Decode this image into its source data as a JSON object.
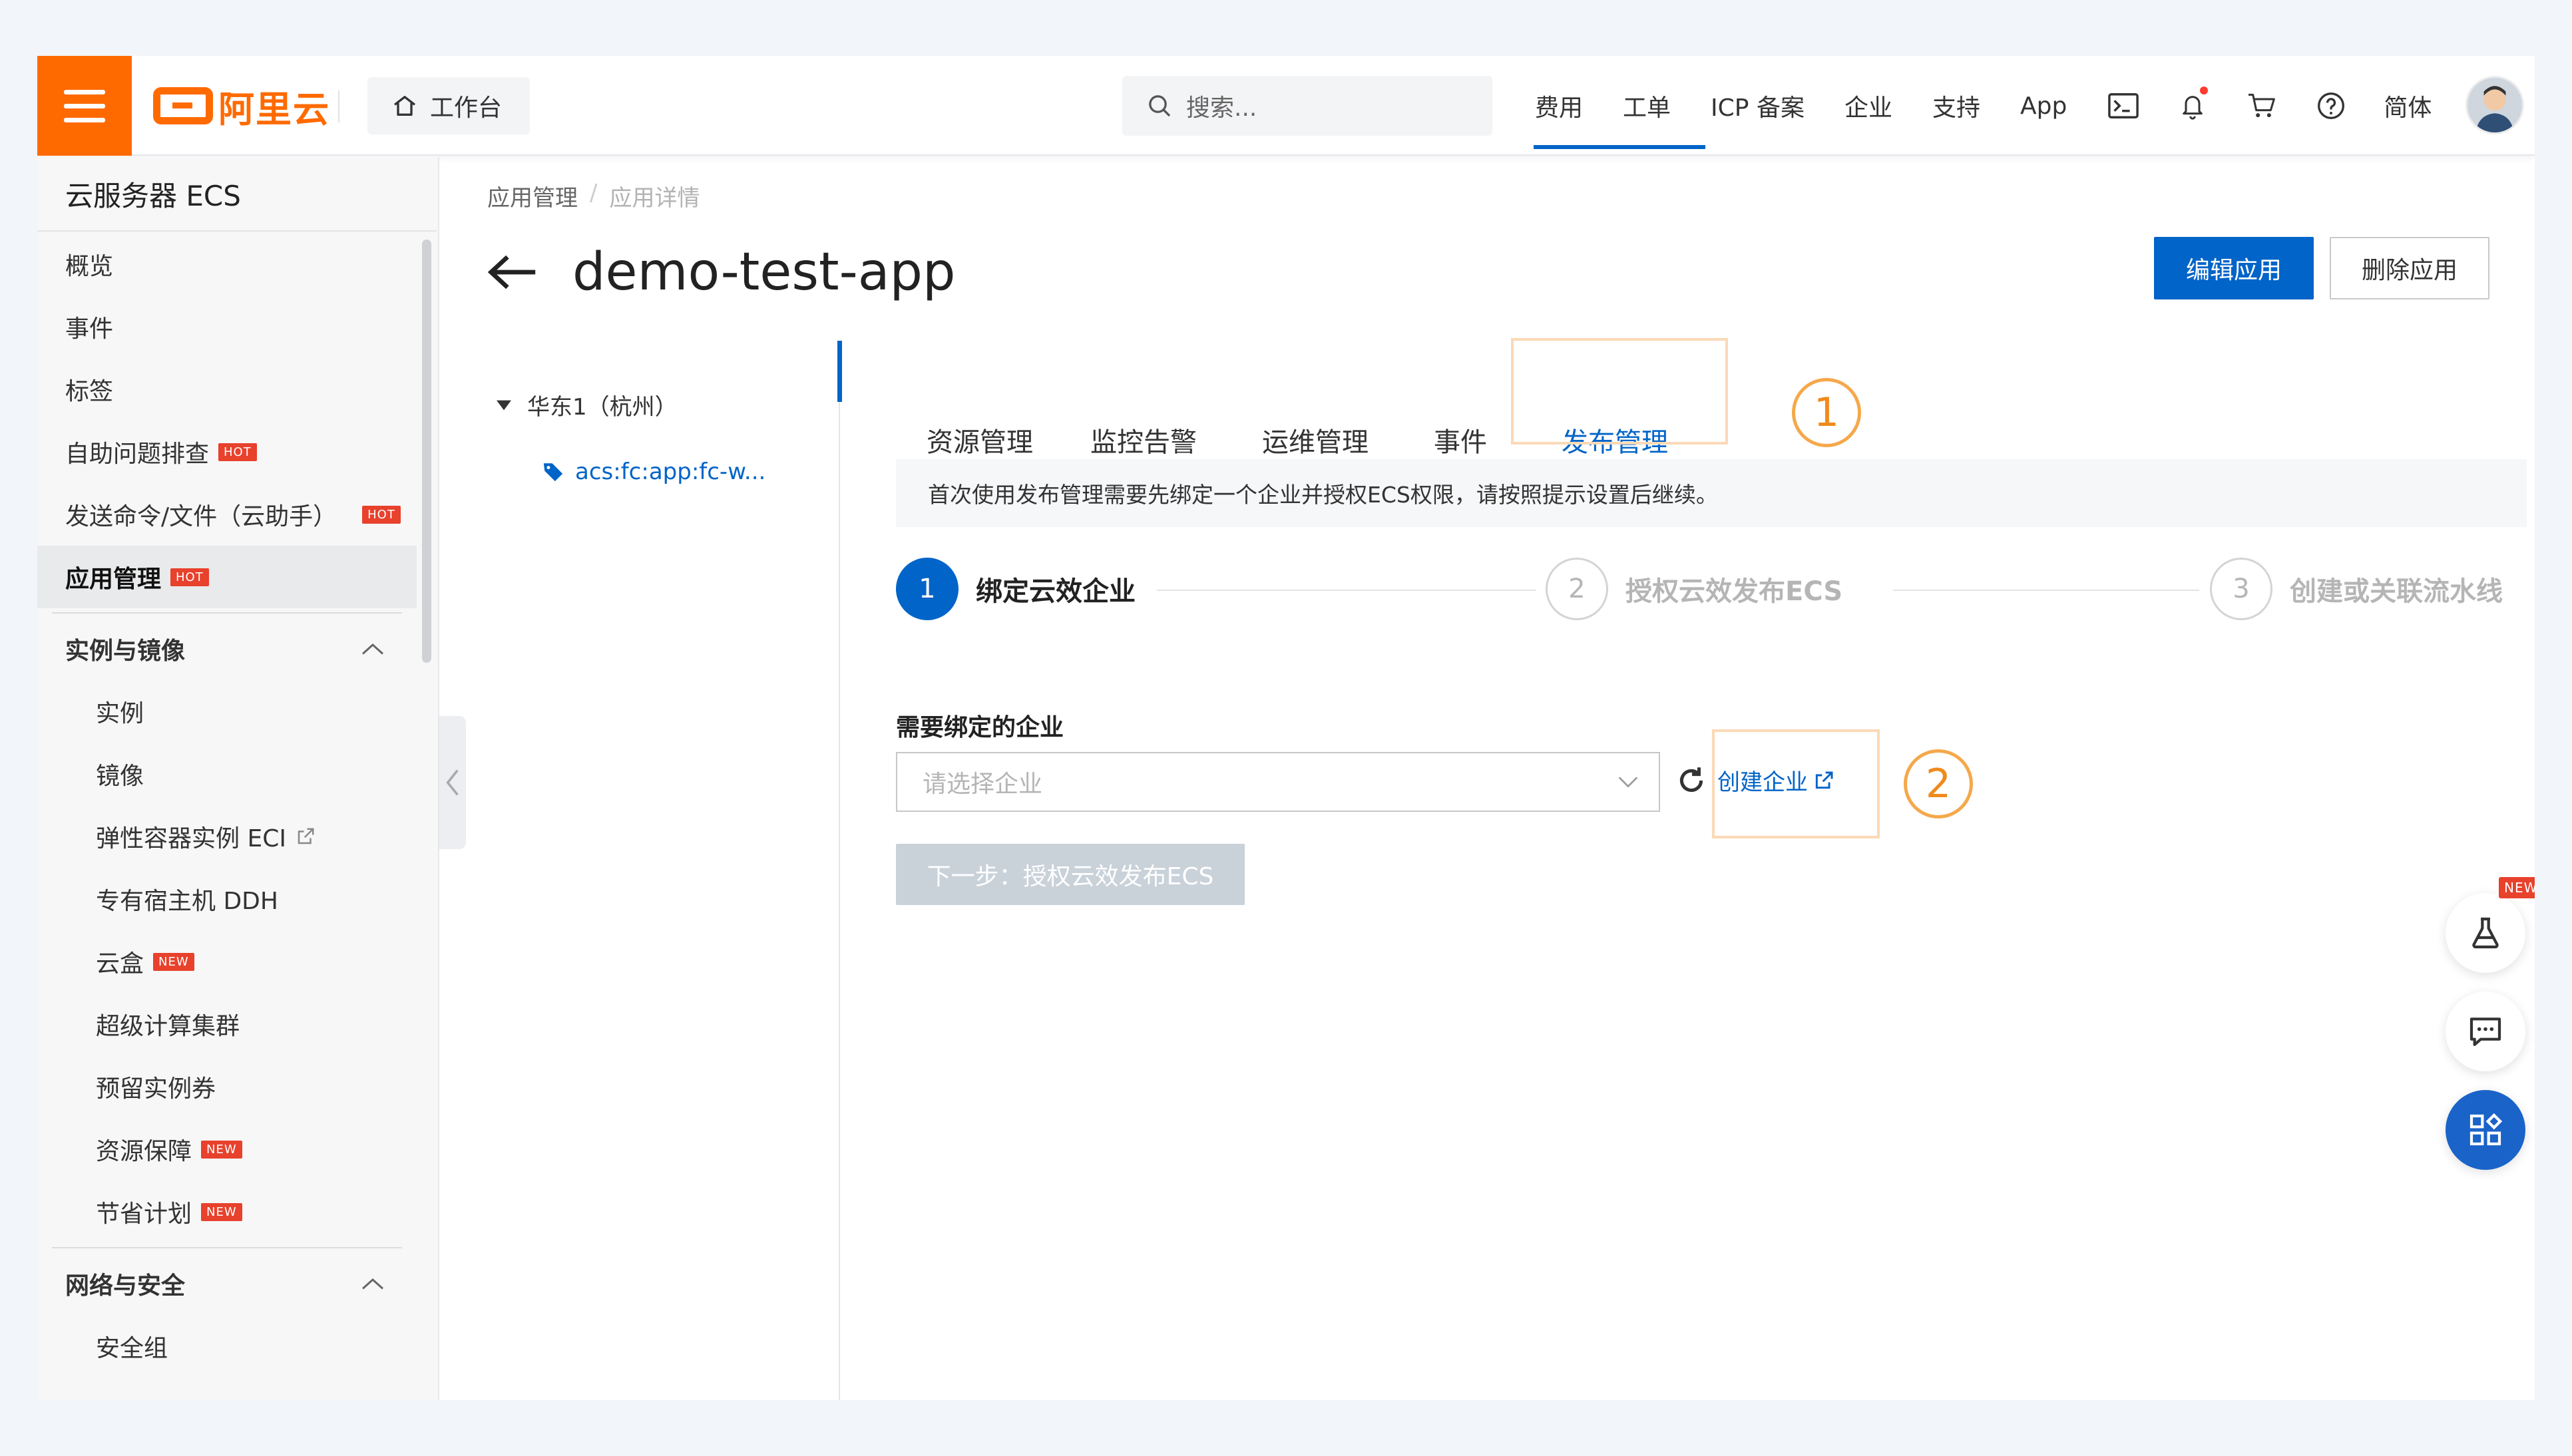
{
  "topbar": {
    "logo_text": "阿里云",
    "workbench": "工作台",
    "search_placeholder": "搜索...",
    "nav": [
      "费用",
      "工单",
      "ICP 备案",
      "企业",
      "支持",
      "App"
    ],
    "lang": "简体",
    "brand_color": "#ff6a00"
  },
  "sidebar": {
    "title": "云服务器 ECS",
    "items": [
      {
        "label": "概览"
      },
      {
        "label": "事件"
      },
      {
        "label": "标签"
      },
      {
        "label": "自助问题排查",
        "badge": "HOT"
      },
      {
        "label": "发送命令/文件（云助手）",
        "badge": "HOT"
      },
      {
        "label": "应用管理",
        "badge": "HOT"
      }
    ],
    "group1": {
      "label": "实例与镜像",
      "items": [
        {
          "label": "实例"
        },
        {
          "label": "镜像"
        },
        {
          "label": "弹性容器实例 ECI"
        },
        {
          "label": "专有宿主机 DDH"
        },
        {
          "label": "云盒",
          "badge": "NEW"
        },
        {
          "label": "超级计算集群"
        },
        {
          "label": "预留实例券"
        },
        {
          "label": "资源保障",
          "badge": "NEW"
        },
        {
          "label": "节省计划",
          "badge": "NEW"
        }
      ]
    },
    "group2": {
      "label": "网络与安全",
      "items": [
        {
          "label": "安全组"
        }
      ]
    }
  },
  "breadcrumb": [
    "应用管理",
    "/",
    "应用详情"
  ],
  "page": {
    "title": "demo-test-app",
    "edit_button": "编辑应用",
    "delete_button": "删除应用"
  },
  "tree": {
    "root": "华东1（杭州）",
    "child": "acs:fc:app:fc-w..."
  },
  "tabs": [
    "资源管理",
    "监控告警",
    "运维管理",
    "事件",
    "发布管理"
  ],
  "annotations": [
    "1",
    "2"
  ],
  "notice": "首次使用发布管理需要先绑定一个企业并授权ECS权限，请按照提示设置后继续。",
  "steps": [
    {
      "num": "1",
      "label": "绑定云效企业"
    },
    {
      "num": "2",
      "label": "授权云效发布ECS"
    },
    {
      "num": "3",
      "label": "创建或关联流水线"
    }
  ],
  "form": {
    "label": "需要绑定的企业",
    "placeholder": "请选择企业",
    "create_link": "创建企业",
    "next_button": "下一步：授权云效发布ECS"
  },
  "float_badge": "NEW",
  "accent_color": "#0064c8"
}
